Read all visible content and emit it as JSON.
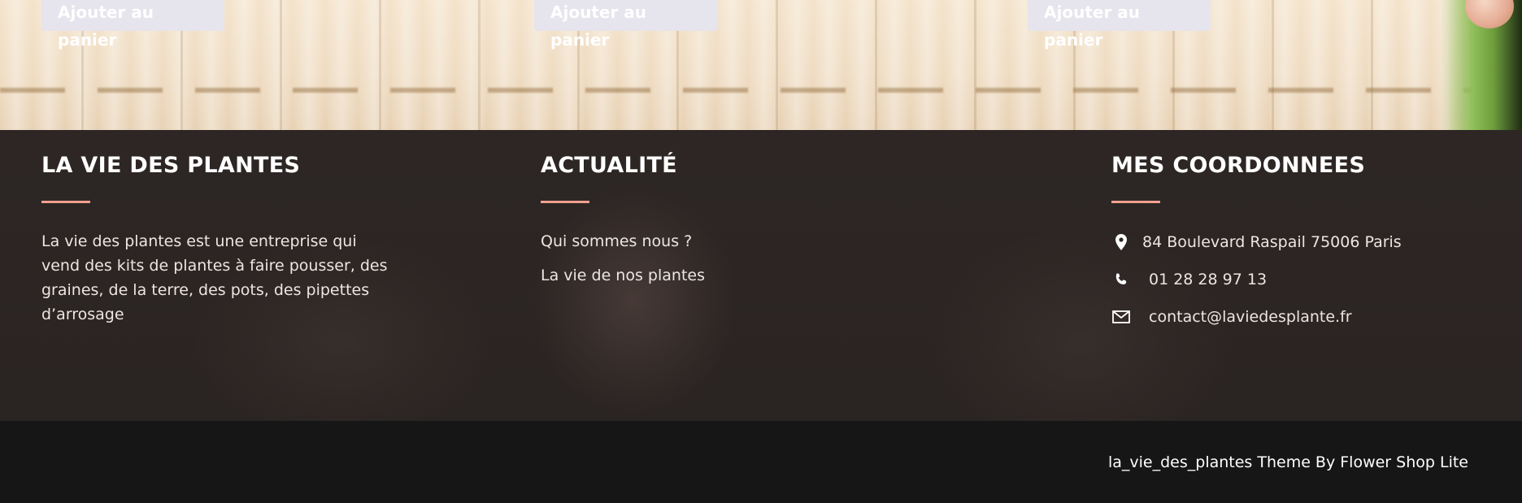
{
  "products": {
    "add_to_cart_label": "Ajouter au panier"
  },
  "footer": {
    "about": {
      "title": "LA VIE DES PLANTES",
      "text": "La vie des plantes est une entreprise qui vend des kits de plantes à faire pousser, des graines, de la terre, des pots, des pipettes d’arrosage"
    },
    "news": {
      "title": "ACTUALITÉ",
      "links": [
        "Qui sommes nous ?",
        "La vie de nos plantes"
      ]
    },
    "contact": {
      "title": "MES COORDONNEES",
      "address": "84 Boulevard Raspail 75006 Paris",
      "phone": "01 28 28 97 13",
      "email": "contact@laviedesplante.fr"
    },
    "credit": "la_vie_des_plantes Theme By Flower Shop Lite"
  },
  "colors": {
    "accent": "#f4a08f",
    "footer_bg": "#2b2523",
    "bottom_bar_bg": "#161616",
    "button_bg": "#e6e4ec"
  },
  "icons": [
    "map-marker-icon",
    "phone-icon",
    "envelope-icon"
  ]
}
